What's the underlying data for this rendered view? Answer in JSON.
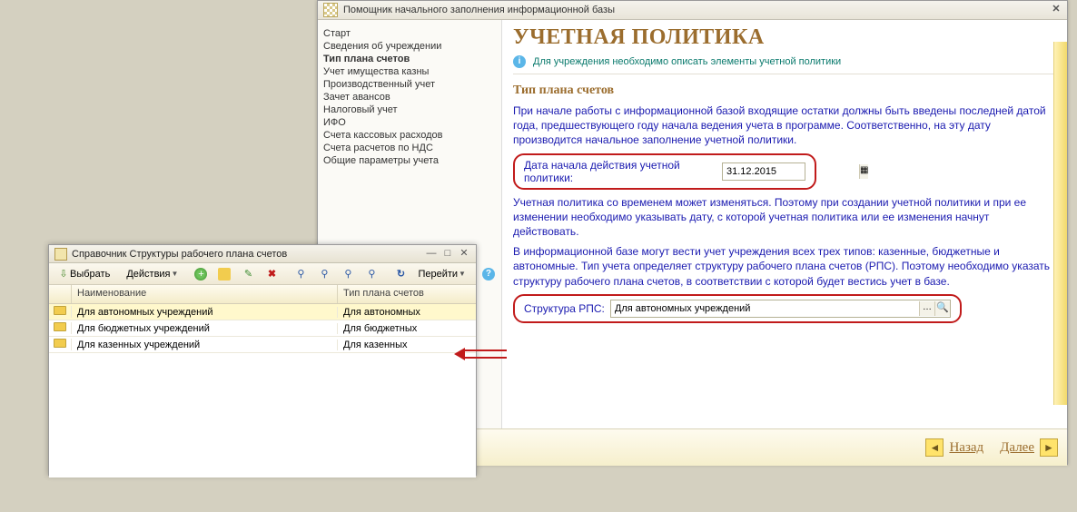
{
  "wizard": {
    "title": "Помощник начального заполнения информационной базы",
    "sidebar": [
      "Старт",
      "Сведения об учреждении",
      "Тип плана счетов",
      "Учет имущества казны",
      "Производственный учет",
      "Зачет авансов",
      "Налоговый учет",
      "ИФО",
      "Счета кассовых расходов",
      "Счета расчетов по НДС",
      "Общие параметры учета"
    ],
    "active_index": 2,
    "heading": "УЧЕТНАЯ ПОЛИТИКА",
    "info": "Для учреждения необходимо описать элементы учетной политики",
    "subheading": "Тип плана счетов",
    "para1": "При начале работы с информационной базой входящие остатки должны быть введены последней датой года, предшествующего году начала ведения учета в программе. Соответственно, на эту дату производится начальное заполнение учетной политики.",
    "date_label": "Дата начала действия учетной политики:",
    "date_value": "31.12.2015",
    "para2": "Учетная политика со временем может изменяться. Поэтому при создании учетной политики и при ее изменении необходимо указывать дату, с которой учетная политика или ее изменения начнут действовать.",
    "para3": "В информационной базе могут вести учет учреждения всех трех типов: казенные, бюджетные и автономные. Тип учета определяет структуру рабочего плана счетов (РПС). Поэтому необходимо указать структуру рабочего плана счетов, в соответствии с которой будет вестись учет в базе.",
    "struct_label": "Структура РПС:",
    "struct_value": "Для автономных учреждений",
    "back_label": "Назад",
    "next_label": "Далее"
  },
  "refwin": {
    "title": "Справочник Структуры рабочего плана счетов",
    "select_label": "Выбрать",
    "actions_label": "Действия",
    "goto_label": "Перейти",
    "col_name": "Наименование",
    "col_type": "Тип плана счетов",
    "rows": [
      {
        "name": "Для автономных учреждений",
        "type": "Для автономных"
      },
      {
        "name": "Для бюджетных учреждений",
        "type": "Для бюджетных"
      },
      {
        "name": "Для казенных учреждений",
        "type": "Для казенных"
      }
    ]
  }
}
